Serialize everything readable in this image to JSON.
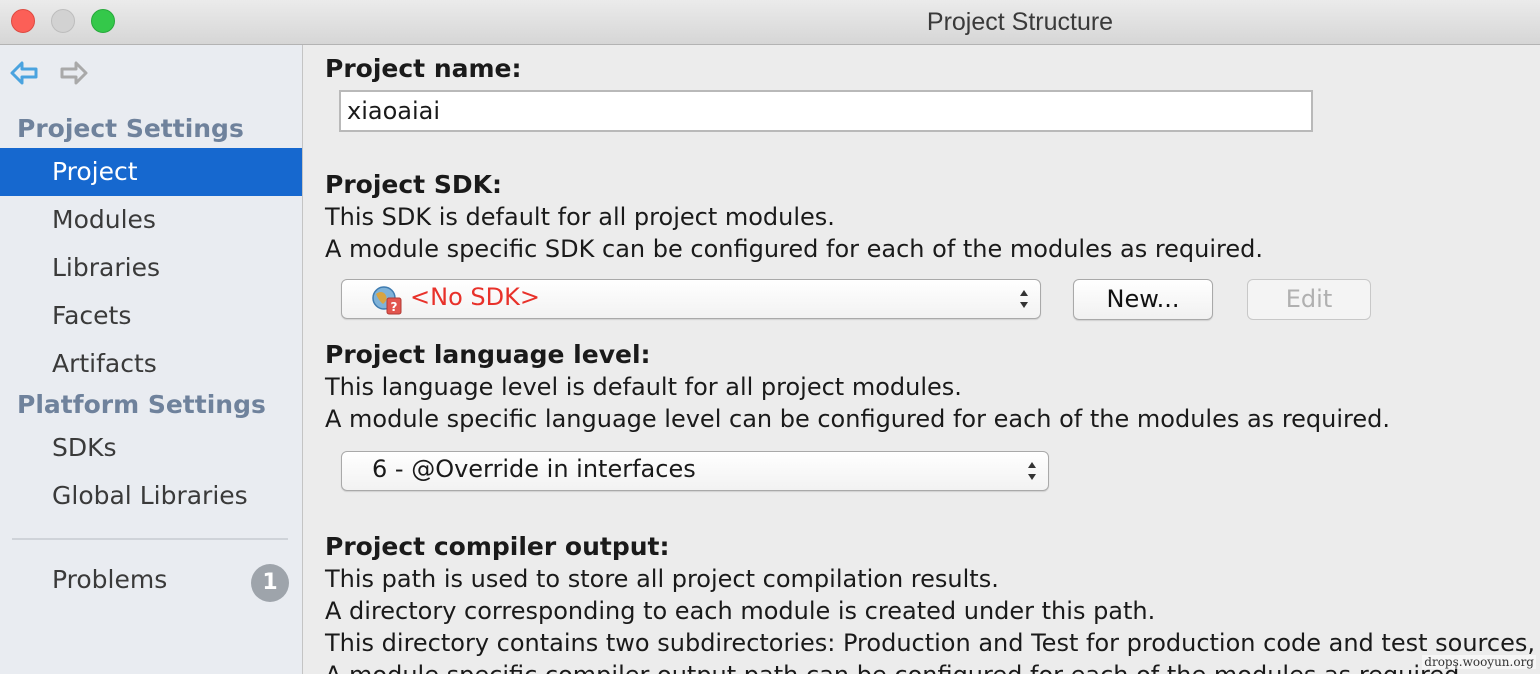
{
  "window": {
    "title": "Project Structure"
  },
  "sidebar": {
    "sections": [
      {
        "header": "Project Settings",
        "items": [
          {
            "label": "Project",
            "selected": true
          },
          {
            "label": "Modules"
          },
          {
            "label": "Libraries"
          },
          {
            "label": "Facets"
          },
          {
            "label": "Artifacts"
          }
        ]
      },
      {
        "header": "Platform Settings",
        "items": [
          {
            "label": "SDKs"
          },
          {
            "label": "Global Libraries"
          }
        ]
      }
    ],
    "problems": {
      "label": "Problems",
      "count": "1"
    }
  },
  "project": {
    "name_label": "Project name:",
    "name_value": "xiaoaiai",
    "sdk": {
      "label": "Project SDK:",
      "desc1": "This SDK is default for all project modules.",
      "desc2": "A module specific SDK can be configured for each of the modules as required.",
      "selected": "<No SDK>",
      "new_button": "New...",
      "edit_button": "Edit"
    },
    "language": {
      "label": "Project language level:",
      "desc1": "This language level is default for all project modules.",
      "desc2": "A module specific language level can be configured for each of the modules as required.",
      "selected": "6 - @Override in interfaces"
    },
    "compiler": {
      "label": "Project compiler output:",
      "desc1": "This path is used to store all project compilation results.",
      "desc2": "A directory corresponding to each module is created under this path.",
      "desc3": "This directory contains two subdirectories: Production and Test for production code and test sources, respectively.",
      "desc4": "A module specific compiler output path can be configured for each of the modules as required."
    }
  },
  "watermark": "drops.wooyun.org",
  "colors": {
    "selection": "#1668cf",
    "section_header": "#6f829c",
    "no_sdk": "#e8312a",
    "nav_back": "#4aa3df",
    "badge": "#9ea4ab"
  }
}
